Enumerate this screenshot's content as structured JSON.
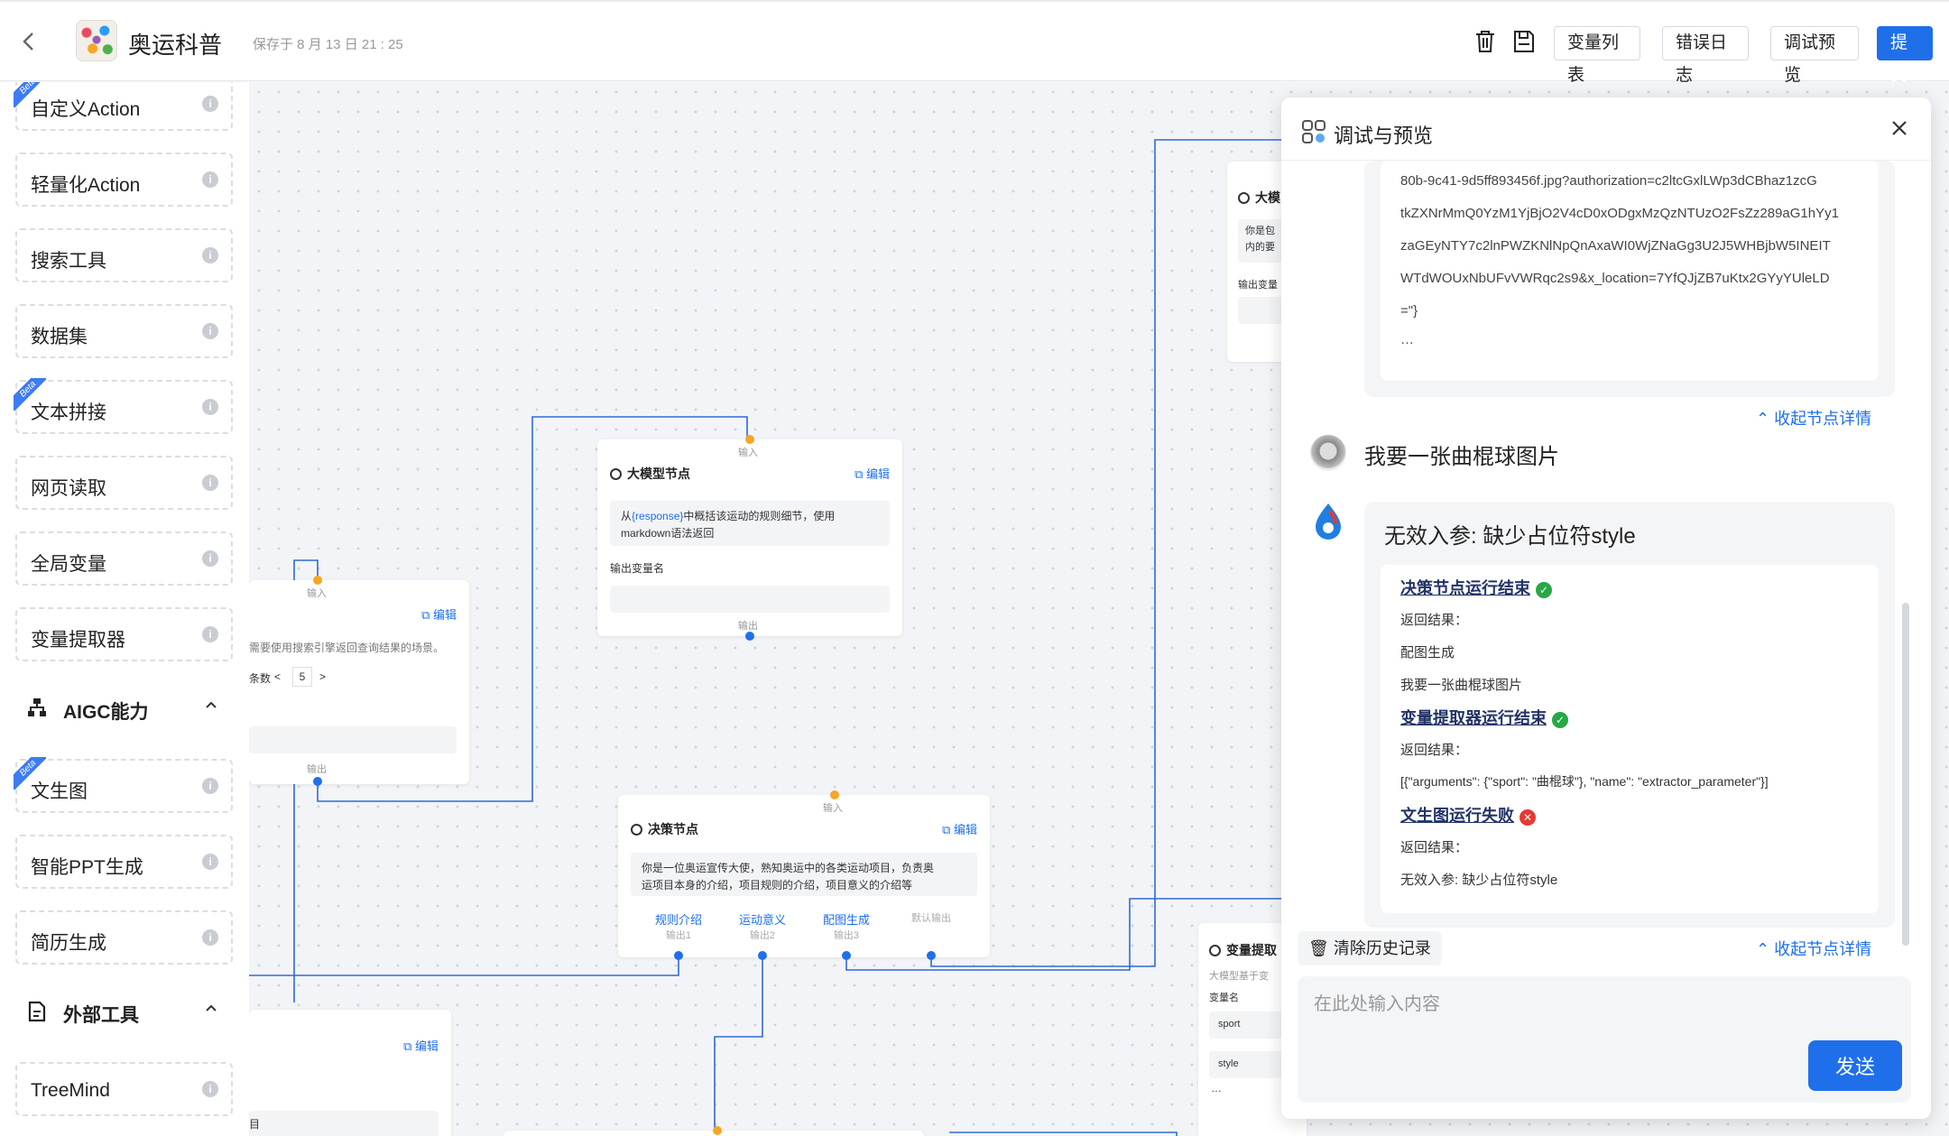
{
  "header": {
    "back_icon": "chevron-left-icon",
    "app_title": "奥运科普",
    "save_time": "保存于 8 月 13 日 21 : 25",
    "delete_icon": "trash-icon",
    "save_icon": "save-icon",
    "buttons": {
      "variables": "变量列表",
      "error_log": "错误日志",
      "debug_preview": "调试预览",
      "submit": "提交"
    }
  },
  "sidebar": {
    "tools": [
      {
        "label": "自定义Action",
        "beta": true
      },
      {
        "label": "轻量化Action",
        "beta": false
      },
      {
        "label": "搜索工具",
        "beta": false
      },
      {
        "label": "数据集",
        "beta": false
      },
      {
        "label": "文本拼接",
        "beta": true
      },
      {
        "label": "网页读取",
        "beta": false
      },
      {
        "label": "全局变量",
        "beta": false
      },
      {
        "label": "变量提取器",
        "beta": false
      }
    ],
    "section_aigc": {
      "title": "AIGC能力",
      "icon": "network-icon"
    },
    "aigc_tools": [
      {
        "label": "文生图",
        "beta": true
      },
      {
        "label": "智能PPT生成",
        "beta": false
      },
      {
        "label": "简历生成",
        "beta": false
      }
    ],
    "section_external": {
      "title": "外部工具",
      "icon": "document-icon"
    },
    "external_tools": [
      {
        "label": "TreeMind",
        "beta": false
      }
    ],
    "beta_label": "Beta"
  },
  "canvas": {
    "common": {
      "input": "输入",
      "output": "输出",
      "edit": "编辑"
    },
    "llm_node": {
      "title": "大模型节点",
      "prompt_prefix": "从",
      "prompt_var": "{response}",
      "prompt_rest": "中概括该运动的规则细节，使用",
      "prompt_line2": "markdown语法返回",
      "output_var_label": "输出变量名"
    },
    "search_node": {
      "desc": "需要使用搜索引擎返回查询结果的场景。",
      "count_label": "条数",
      "count_value": "5",
      "prev": "<",
      "next": ">"
    },
    "decision_node": {
      "title": "决策节点",
      "prompt_line1": "你是一位奥运宣传大使，熟知奥运中的各类运动项目，负责奥",
      "prompt_line2": "运项目本身的介绍，项目规则的介绍，项目意义的介绍等",
      "branches": [
        {
          "label": "规则介绍",
          "sub": "输出1"
        },
        {
          "label": "运动意义",
          "sub": "输出2"
        },
        {
          "label": "配图生成",
          "sub": "输出3"
        },
        {
          "label": "",
          "sub": "默认输出"
        }
      ]
    },
    "top_right_node": {
      "title": "大模",
      "line1": "你是包",
      "line2": "内的要",
      "output_var_label": "输出变量"
    },
    "extractor_node": {
      "title": "变量提取",
      "desc": "大模型基于变",
      "var_label": "变量名",
      "vars": [
        "sport",
        "style"
      ],
      "more": "…"
    },
    "bottom_left_node": {
      "field_tail": "目"
    }
  },
  "debug_panel": {
    "title": "调试与预览",
    "title_icon": "debug-icon",
    "close_icon": "close-icon",
    "prev_result_lines": [
      "80b-9c41-9d5ff893456f.jpg?authorization=c2ltcGxlLWp3dCBhaz1zcG",
      "tkZXNrMmQ0YzM1YjBjO2V4cD0xODgxMzQzNTUzO2FsZz289aG1hYy1",
      "zaGEyNTY7c2lnPWZKNlNpQnAxaWI0WjZNaGg3U2J5WHBjbW5INEIT",
      "WTdWOUxNbUFvVWRqc2s9&x_location=7YfQJjZB7uKtx2GYyYUleLD",
      "=\"}",
      "…"
    ],
    "collapse_label": "收起节点详情",
    "user_message": "我要一张曲棍球图片",
    "bot_message": "无效入参: 缺少占位符style",
    "steps": [
      {
        "title": "决策节点运行结束",
        "status": "success",
        "lines": [
          "返回结果：",
          "配图生成",
          "我要一张曲棍球图片"
        ]
      },
      {
        "title": "变量提取器运行结束",
        "status": "success",
        "lines": [
          "返回结果：",
          "[{\"arguments\": {\"sport\": \"曲棍球\"}, \"name\": \"extractor_parameter\"}]"
        ]
      },
      {
        "title": "文生图运行失败",
        "status": "fail",
        "lines": [
          "返回结果：",
          "无效入参: 缺少占位符style"
        ]
      }
    ],
    "clear_history": "清除历史记录",
    "input_placeholder": "在此处输入内容",
    "send": "发送"
  }
}
